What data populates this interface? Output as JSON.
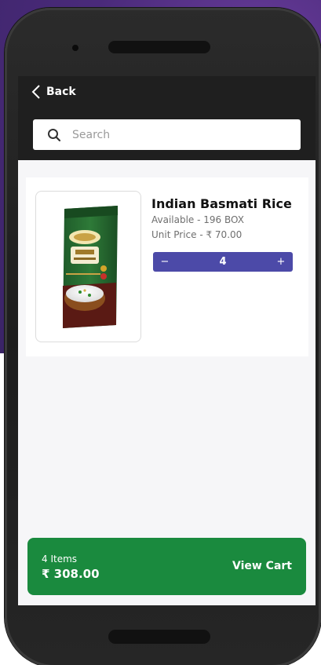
{
  "header": {
    "back_label": "Back"
  },
  "search": {
    "placeholder": "Search"
  },
  "product": {
    "name": "Indian Basmati Rice",
    "availability": "Available - 196 BOX",
    "unit_price": "Unit Price - ₹ 70.00",
    "quantity": "4",
    "decrement_label": "−",
    "increment_label": "+",
    "image_icon": "rice-bag-icon"
  },
  "cart": {
    "items_label": "4 Items",
    "total": "₹ 308.00",
    "view_cart_label": "View Cart"
  },
  "colors": {
    "topbar": "#1f1f1f",
    "stepper": "#4c4aa8",
    "cart_bar": "#1a8a3e",
    "background_purple": "#4a2a7a"
  }
}
